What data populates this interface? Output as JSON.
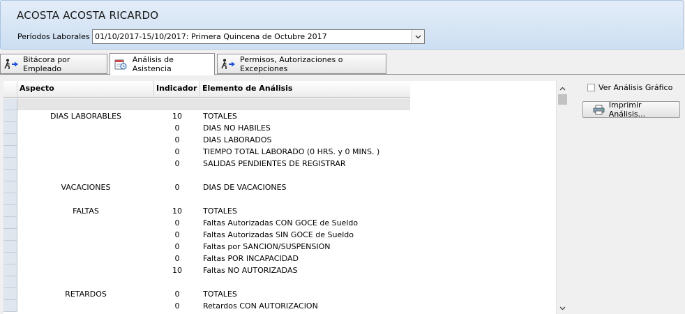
{
  "header": {
    "employee_name": "ACOSTA ACOSTA RICARDO",
    "period_label": "Períodos Laborales",
    "period_value": "01/10/2017-15/10/2017: Primera Quincena de Octubre 2017"
  },
  "tabs": [
    {
      "label": "Bitácora por Empleado",
      "icon": "runner-arrow-icon",
      "active": false
    },
    {
      "label": "Análisis de Asistencia",
      "icon": "calendar-clock-icon",
      "active": true
    },
    {
      "label": "Permisos, Autorizaciones o Excepciones",
      "icon": "runner-arrow-icon",
      "active": false
    }
  ],
  "grid": {
    "columns": {
      "aspect": "Aspecto",
      "indicator": "Indicador",
      "element": "Elemento de Análisis"
    },
    "rows": [
      {
        "aspect": "",
        "indicator": "",
        "element": "",
        "band": true
      },
      {
        "aspect": "DIAS LABORABLES",
        "indicator": "10",
        "element": "TOTALES"
      },
      {
        "aspect": "",
        "indicator": "0",
        "element": "DIAS NO HABILES"
      },
      {
        "aspect": "",
        "indicator": "0",
        "element": "DIAS LABORADOS"
      },
      {
        "aspect": "",
        "indicator": "0",
        "element": "TIEMPO TOTAL LABORADO (0 HRS. y 0 MINS. )"
      },
      {
        "aspect": "",
        "indicator": "0",
        "element": "SALIDAS PENDIENTES DE REGISTRAR"
      },
      {
        "aspect": "",
        "indicator": "",
        "element": ""
      },
      {
        "aspect": "VACACIONES",
        "indicator": "0",
        "element": "DIAS DE VACACIONES"
      },
      {
        "aspect": "",
        "indicator": "",
        "element": ""
      },
      {
        "aspect": "FALTAS",
        "indicator": "10",
        "element": "TOTALES"
      },
      {
        "aspect": "",
        "indicator": "0",
        "element": "Faltas Autorizadas CON GOCE de Sueldo"
      },
      {
        "aspect": "",
        "indicator": "0",
        "element": "Faltas Autorizadas SIN GOCE de Sueldo"
      },
      {
        "aspect": "",
        "indicator": "0",
        "element": "Faltas por SANCION/SUSPENSION"
      },
      {
        "aspect": "",
        "indicator": "0",
        "element": "Faltas POR INCAPACIDAD"
      },
      {
        "aspect": "",
        "indicator": "10",
        "element": "Faltas NO AUTORIZADAS"
      },
      {
        "aspect": "",
        "indicator": "",
        "element": ""
      },
      {
        "aspect": "RETARDOS",
        "indicator": "0",
        "element": "TOTALES"
      },
      {
        "aspect": "",
        "indicator": "0",
        "element": "Retardos CON AUTORIZACION"
      }
    ]
  },
  "side": {
    "chart_checkbox_label": "Ver Análisis Gráfico",
    "chart_checkbox_checked": false,
    "print_button_label": "Imprimir Análisis..."
  },
  "icons": {
    "dropdown": "chevron-down-icon",
    "scroll_up": "chevron-up-icon",
    "scroll_down": "chevron-down-icon",
    "print": "printer-icon"
  },
  "colors": {
    "header_gradient_top": "#e3edf8",
    "header_gradient_bottom": "#cddff3",
    "row_header": "#dfe6ee",
    "band_row": "#e5e5e5"
  }
}
